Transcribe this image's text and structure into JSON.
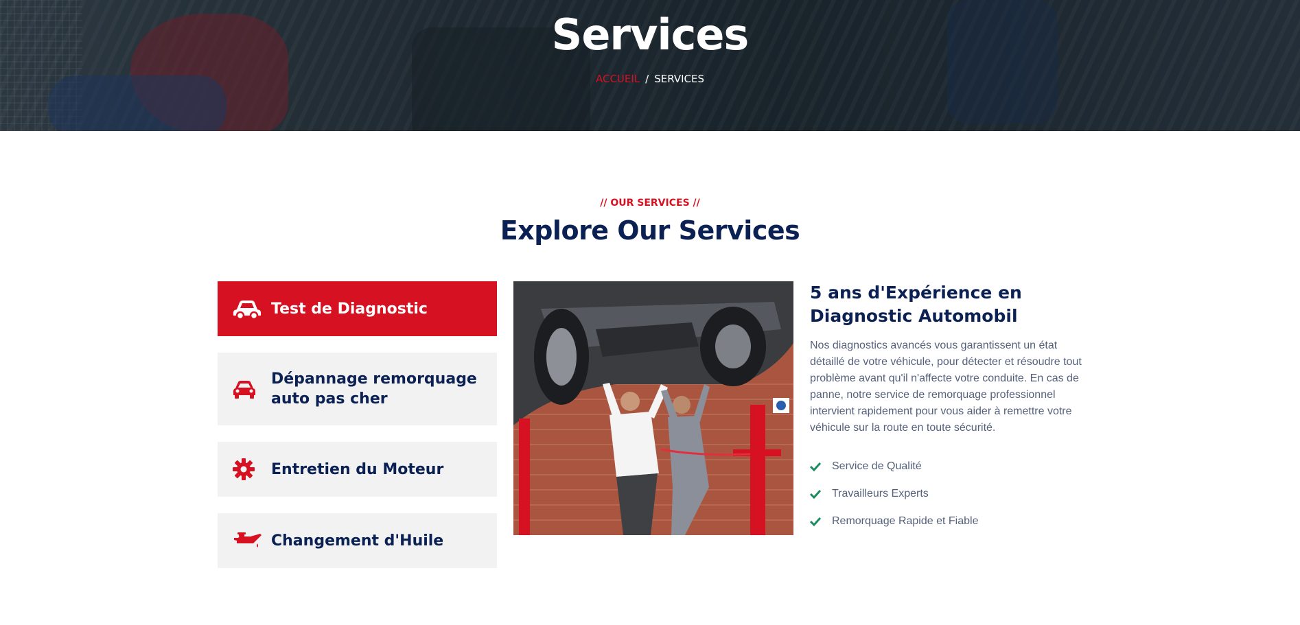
{
  "hero": {
    "title": "Services",
    "breadcrumb": {
      "home": "ACCUEIL",
      "separator": "/",
      "current": "SERVICES"
    }
  },
  "section": {
    "eyebrow": "// OUR SERVICES //",
    "title": "Explore Our Services"
  },
  "services": [
    {
      "label": "Test de Diagnostic",
      "icon": "car-icon",
      "active": true
    },
    {
      "label": "Dépannage remorquage auto pas cher",
      "icon": "car-front-icon",
      "active": false
    },
    {
      "label": "Entretien du Moteur",
      "icon": "gear-icon",
      "active": false
    },
    {
      "label": "Changement d'Huile",
      "icon": "oil-can-icon",
      "active": false
    }
  ],
  "detail": {
    "title": "5 ans d'Expérience en Diagnostic Automobil",
    "text": "Nos diagnostics avancés vous garantissent un état détaillé de votre véhicule, pour détecter et résoudre tout problème avant qu'il n'affecte votre conduite. En cas de panne, notre service de remorquage professionnel intervient rapidement pour vous aider à remettre votre véhicule sur la route en toute sécurité.",
    "checklist": [
      "Service de Qualité",
      "Travailleurs Experts",
      "Remorquage Rapide et Fiable"
    ]
  },
  "colors": {
    "accent": "#d61122",
    "navy": "#0b2154",
    "check": "#1c8c5e",
    "menu_bg": "#f2f2f2",
    "body_text": "#55617a"
  }
}
